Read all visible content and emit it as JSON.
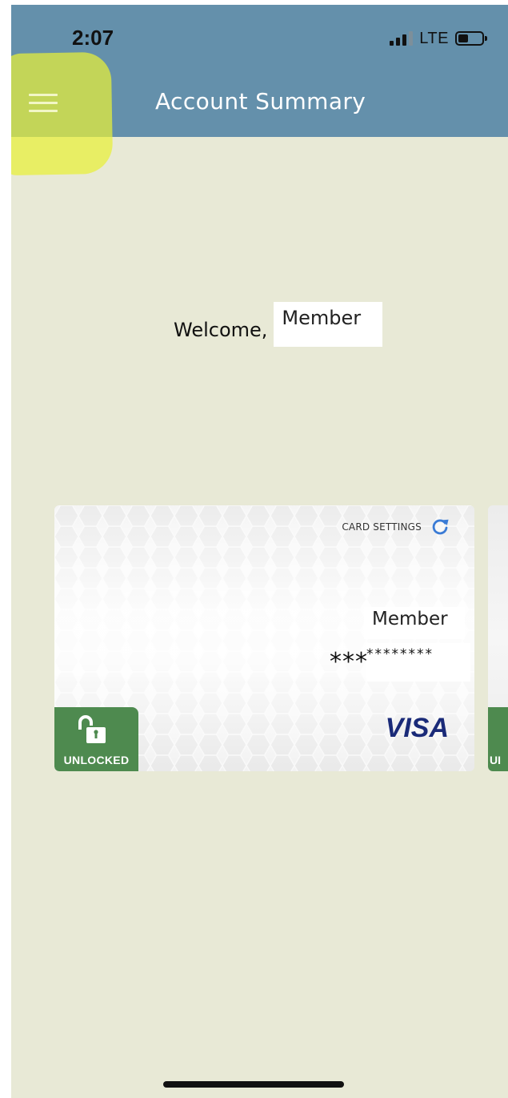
{
  "status_bar": {
    "time": "2:07",
    "network": "LTE"
  },
  "header": {
    "title": "Account Summary",
    "menu_icon": "hamburger-menu-icon"
  },
  "welcome": {
    "greeting": "Welcome,",
    "member_name": "Member"
  },
  "card": {
    "settings_label": "CARD SETTINGS",
    "settings_icon": "refresh-icon",
    "holder_name": "Member",
    "number_prefix": "***",
    "number_masked": "********",
    "lock_status": "UNLOCKED",
    "lock_icon": "unlocked-padlock-icon",
    "network_brand": "VISA"
  },
  "next_card": {
    "lock_status_partial": "UI"
  },
  "colors": {
    "header": "#6490ab",
    "background": "#e8e9d6",
    "lock_badge": "#4e8a4f",
    "visa_blue": "#1a2a78",
    "refresh_icon": "#3a7bd5",
    "highlight": "#e7f038"
  }
}
